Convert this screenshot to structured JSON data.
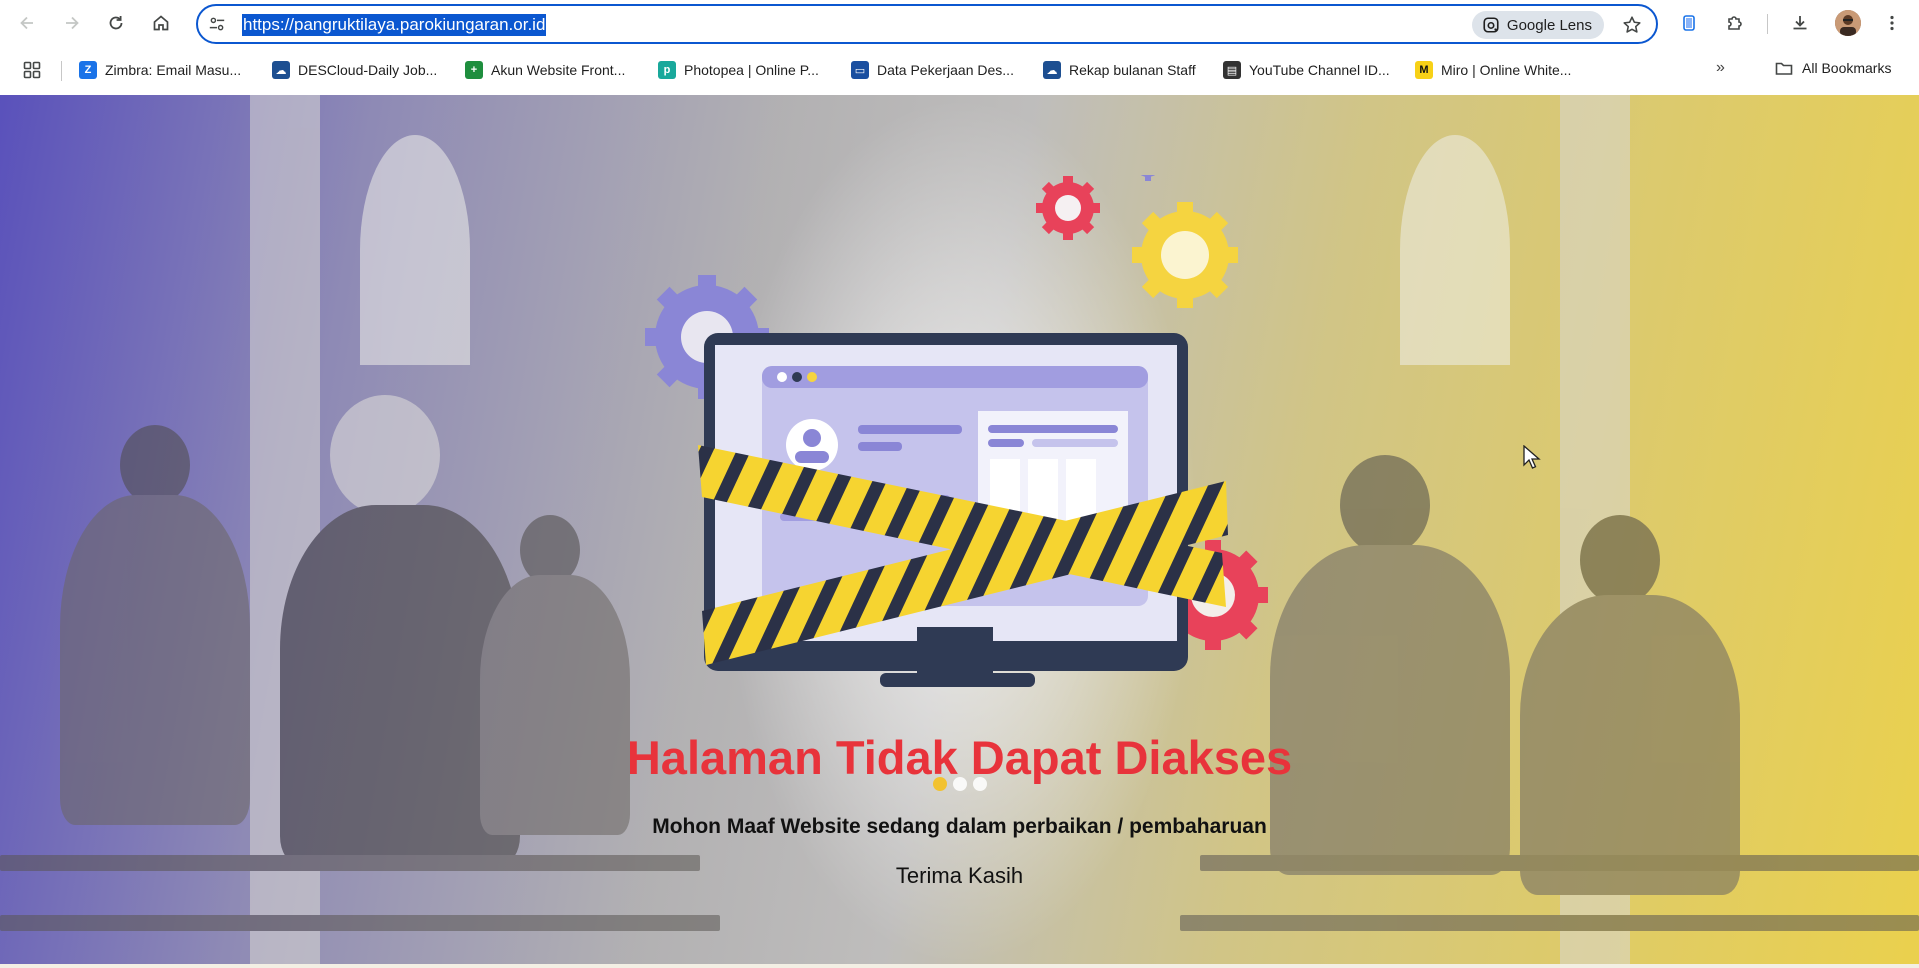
{
  "browser": {
    "url": "https://pangruktilaya.parokiungaran.or.id",
    "lens_label": "Google Lens",
    "icons": [
      "back-icon",
      "forward-icon",
      "reload-icon",
      "home-icon",
      "site-info-icon",
      "google-lens-icon",
      "bookmark-star-icon",
      "tab-search-icon",
      "extensions-icon",
      "downloads-icon",
      "profile-avatar",
      "more-menu-icon"
    ]
  },
  "bookmarks": {
    "items": [
      {
        "label": "Zimbra: Email Masu...",
        "fav_color": "#1a73e8",
        "fav_glyph": "Z"
      },
      {
        "label": "DESCloud-Daily Job...",
        "fav_color": "#1d4f91",
        "fav_glyph": "☁"
      },
      {
        "label": "Akun Website Front...",
        "fav_color": "#1e8e3e",
        "fav_glyph": "+"
      },
      {
        "label": "Photopea | Online P...",
        "fav_color": "#19a89b",
        "fav_glyph": "p"
      },
      {
        "label": "Data Pekerjaan Des...",
        "fav_color": "#1a4fa0",
        "fav_glyph": "▭"
      },
      {
        "label": "Rekap bulanan Staff",
        "fav_color": "#1d4f91",
        "fav_glyph": "☁"
      },
      {
        "label": "YouTube Channel ID...",
        "fav_color": "#333333",
        "fav_glyph": "▤"
      },
      {
        "label": "Miro | Online White...",
        "fav_color": "#f7d117",
        "fav_glyph": "M"
      }
    ],
    "more_label": "»",
    "all_label": "All Bookmarks"
  },
  "page": {
    "title": "Halaman Tidak Dapat Diakses",
    "subtitle": "Mohon Maaf Website sedang dalam perbaikan / pembaharuan",
    "thanks": "Terima Kasih",
    "title_color": "#e8333b",
    "gradient_left": "#544bbe",
    "gradient_right": "#f8da40"
  }
}
